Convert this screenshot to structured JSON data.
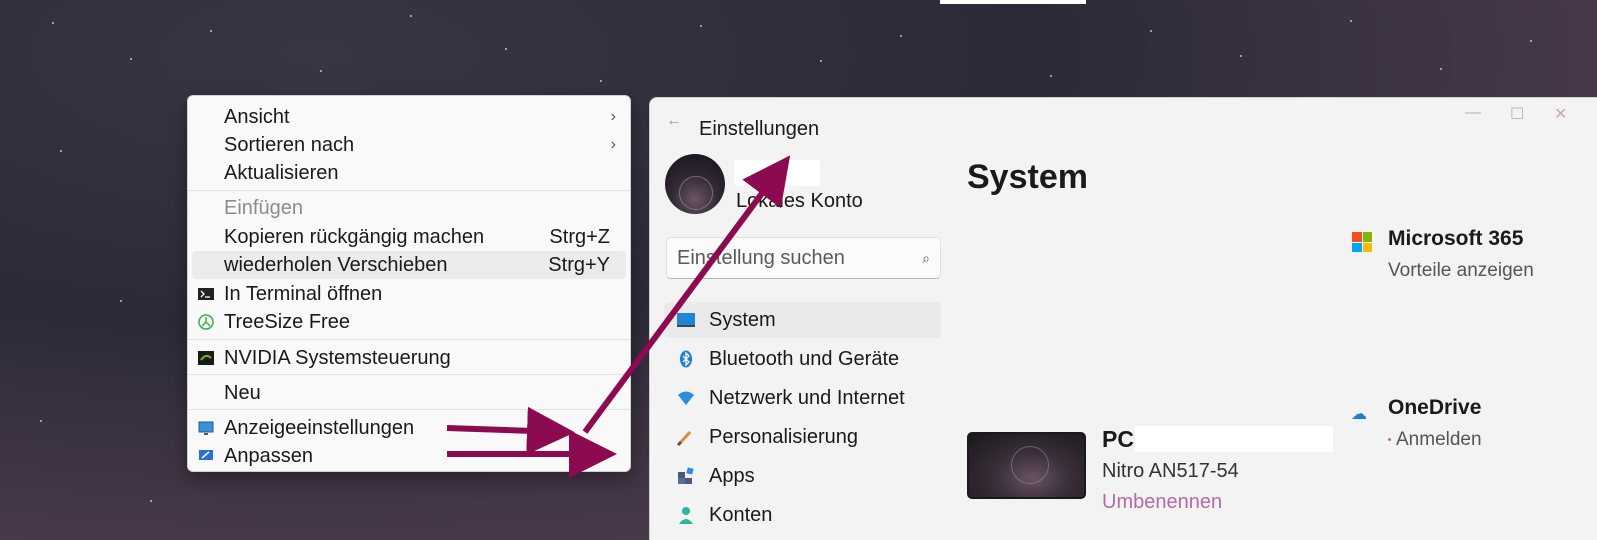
{
  "context_menu": {
    "items": [
      {
        "label": "Ansicht",
        "submenu": true
      },
      {
        "label": "Sortieren nach",
        "submenu": true
      },
      {
        "label": "Aktualisieren"
      },
      {
        "label": "Einfügen",
        "disabled": true
      },
      {
        "label": "Kopieren rückgängig machen",
        "shortcut": "Strg+Z"
      },
      {
        "label": "wiederholen Verschieben",
        "shortcut": "Strg+Y"
      },
      {
        "label": "In  Terminal öffnen",
        "icon": "terminal-icon"
      },
      {
        "label": "TreeSize Free",
        "icon": "treesize-icon"
      },
      {
        "label": "NVIDIA Systemsteuerung",
        "icon": "nvidia-icon"
      },
      {
        "label": "Neu",
        "submenu": true
      },
      {
        "label": "Anzeigeeinstellungen",
        "icon": "display-icon"
      },
      {
        "label": "Anpassen",
        "icon": "personalize-icon"
      }
    ]
  },
  "settings": {
    "title": "Einstellungen",
    "account_type": "Lokales Konto",
    "search_placeholder": "Einstellung suchen",
    "nav": [
      {
        "label": "System",
        "icon": "system-icon"
      },
      {
        "label": "Bluetooth und Geräte",
        "icon": "bluetooth-icon"
      },
      {
        "label": "Netzwerk und Internet",
        "icon": "wifi-icon"
      },
      {
        "label": "Personalisierung",
        "icon": "brush-icon"
      },
      {
        "label": "Apps",
        "icon": "apps-icon"
      },
      {
        "label": "Konten",
        "icon": "account-icon"
      }
    ],
    "page_title": "System",
    "pc": {
      "name": "PC",
      "model": "Nitro AN517-54",
      "rename": "Umbenennen"
    },
    "ms365": {
      "title": "Microsoft 365",
      "sub": "Vorteile anzeigen"
    },
    "onedrive": {
      "title": "OneDrive",
      "sub": "Anmelden"
    }
  },
  "colors": {
    "annotation_arrow": "#8b0a50",
    "accent": "#b46aa8"
  }
}
